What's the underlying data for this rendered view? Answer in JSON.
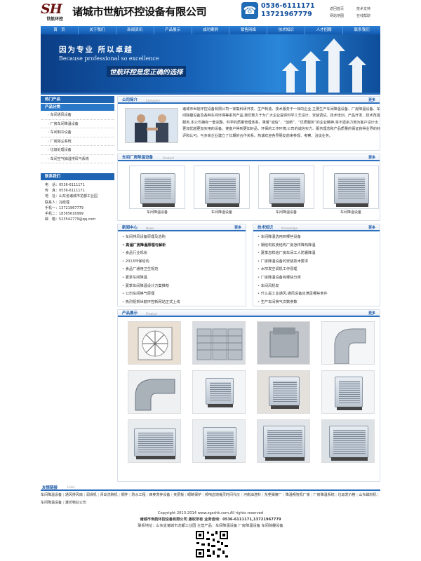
{
  "header": {
    "logo_mark": "SH",
    "logo_sub": "世航环控",
    "company": "诸城市世航环控设备有限公司",
    "tel1": "0536-6111171",
    "tel2": "13721967779",
    "toplinks": [
      "返回首页",
      "技术支持",
      "网站地图",
      "在线帮助"
    ]
  },
  "nav": [
    "首　页",
    "关于我们",
    "新闻资讯",
    "产品展示",
    "成功案例",
    "销售网络",
    "技术知识",
    "人才招聘",
    "联系我们"
  ],
  "banner": {
    "line1": "因为专业 所以卓越",
    "line2": "Because professional so excellence",
    "line3": "世航环控是您正确的选择"
  },
  "sidebar": {
    "hot_title": "热门产品",
    "cat_title": "产品分类",
    "categories": [
      "车间通风设备",
      "厂房车间降温设备",
      "车间制冷设备",
      "厂房除尘系统",
      "垃圾处理设备",
      "车间空气抽湿排风气系统"
    ],
    "contact_title": "联系我们",
    "contact": [
      "电　话：0536-6111171",
      "传　真：0536-6111171",
      "地　址：山东省诸城市龙都工业园",
      "联系人：冯经理",
      "手机一：13721967779",
      "手机二：18365616999",
      "邮　箱：523542779@qq.com"
    ]
  },
  "about": {
    "title": "公司简介",
    "en": "Company",
    "more": "更多",
    "text": "诸城市世航环控设备有限公司一家集科研开发、生产制造、技术服务于一体的企业,主要生产车间降温设备、厂房降温设备、车间除霾设备及各种车间环保等系列产品,我们致力于为广大企业提供科学工艺设计、安装调试、技术培训、产品开发、技术改造服务,本公司拥有一套完整、科学的质量管理体系。秉着“诚信”、“创新”、“优质服务”的企业精神,将不遗余力地为客户设计出更加优越更加实用的设备。使客户得到更加好品、环保的工作环境;公司的诚信实力、服务理念和产品质量的保证获得业界的好评和认可。与多家企业建立了长期的合作关系。热诚欢迎各界朋友前来参观、考察、洽谈业务。"
  },
  "products": {
    "title": "车间厂房降温设备",
    "en": "Product",
    "more": "更多",
    "items": [
      "车间降温设备",
      "车间降温设备",
      "车间降温设备",
      "车间降温设备"
    ]
  },
  "news": {
    "title": "新闻中心",
    "en": "News",
    "more": "更多",
    "items": [
      "车间排风设备原理及选购",
      "高温厂房降温原理与解析",
      "食品行业现状",
      "2013环保动向",
      "食品厂通用卫生规范",
      "夏季车间降温",
      "夏季车间降温设计方案推荐",
      "公司车间换气原理",
      "热烈祝贺世航环控新网站正式上线"
    ],
    "bold_index": 1
  },
  "knowledge": {
    "title": "技术知识",
    "en": "Knowledge",
    "more": "更多",
    "items": [
      "车间降温选用到哪些设备",
      "钢结构铁皮结构厂房怎样降热降温",
      "夏季怎样给厂房车间工人防暑降温",
      "厂房降温设备的安装技术要求",
      "水帘发空调机工作原理",
      "厂房降温设备有哪些分类",
      "车间风机安",
      "什么是工业通风,通风设备应满足哪些条件",
      "生产车间换气次数参数"
    ]
  },
  "gallery": {
    "title": "产品展示",
    "en": "Product",
    "more": "更多"
  },
  "links": {
    "title": "友情链接",
    "en": "Links",
    "items": [
      "车间降温设备",
      "通风排风扇",
      "润滑机",
      "青岛洗碗机",
      "钢件",
      "防水工程",
      "西奥宠养设备",
      "夹层板",
      "眼睛保护",
      "频响血饱缩灵时间代仪",
      "河南油渣料",
      "东莞弹簧厂",
      "降温畅管机厂家",
      "厂房降温系统",
      "垃圾发价格",
      "山东磁粉机",
      "车间降温设备",
      "潍坊物业公司"
    ]
  },
  "footer": {
    "line1": "Copyright 2013-2014 www.zgsshk.com,All rights reserved",
    "line2": "诸城市世航环控设备有限公司 版权所有 业务咨询：0536-6111171,13721967779",
    "line3": "联系地址：山东省诸城市龙都工业园 主营产品：车间降温设备 厂房降温设备 车间除霾设备"
  },
  "colors": {
    "brand": "#1f63b3",
    "accent": "#6b1212"
  }
}
